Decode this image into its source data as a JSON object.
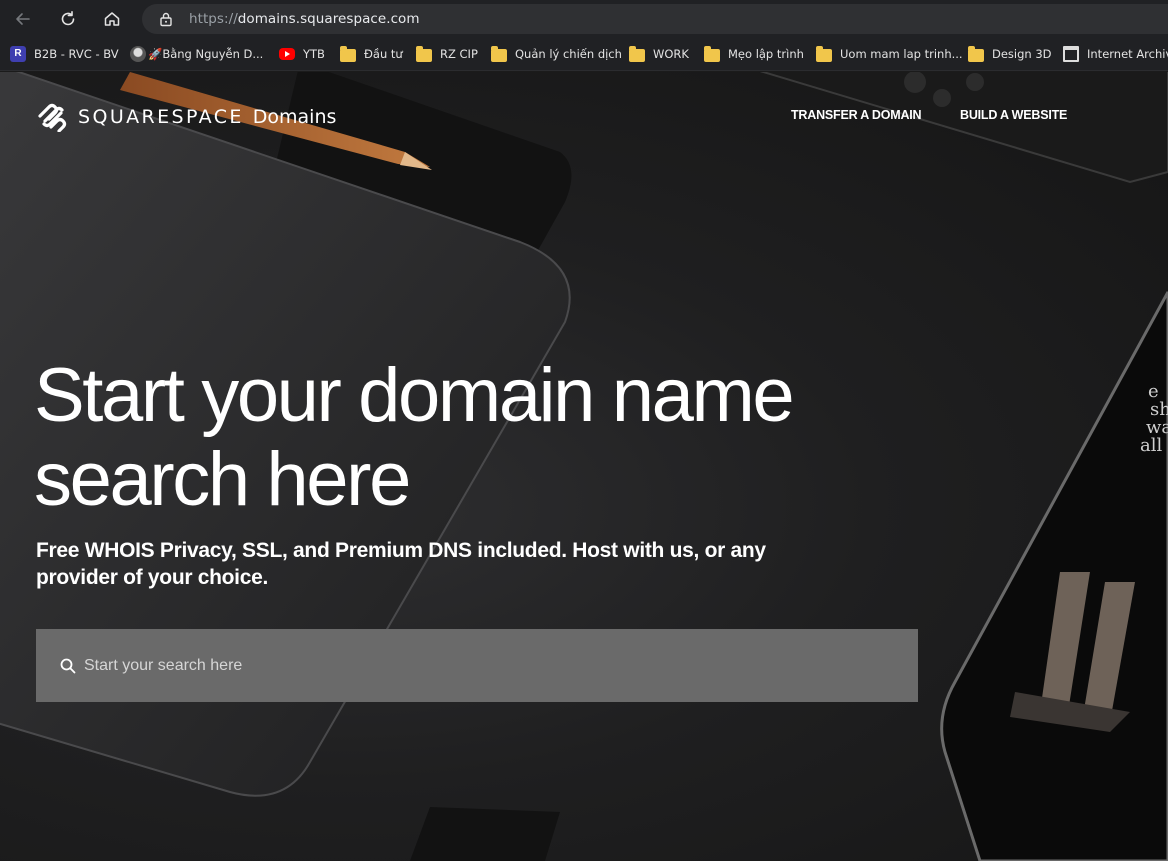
{
  "browser": {
    "url_scheme": "https://",
    "url_host": "domains.squarespace.com",
    "icons": {
      "back": "arrow-left-icon",
      "reload": "reload-icon",
      "home": "home-icon",
      "lock": "lock-icon"
    }
  },
  "bookmarks": [
    {
      "label": "B2B - RVC - BV",
      "icon": "r-app-icon"
    },
    {
      "label": "🚀Bằng Nguyễn D...",
      "icon": "avatar-icon"
    },
    {
      "label": "YTB",
      "icon": "youtube-icon"
    },
    {
      "label": "Đầu tư",
      "icon": "folder-icon"
    },
    {
      "label": "RZ CIP",
      "icon": "folder-icon"
    },
    {
      "label": "Quản lý chiến dịch",
      "icon": "folder-icon"
    },
    {
      "label": "WORK",
      "icon": "folder-icon"
    },
    {
      "label": "Mẹo lập trình",
      "icon": "folder-icon"
    },
    {
      "label": "Uom mam lap trinh...",
      "icon": "folder-icon"
    },
    {
      "label": "Design 3D",
      "icon": "folder-icon"
    },
    {
      "label": "Internet Archive",
      "icon": "museum-icon"
    }
  ],
  "site": {
    "logo_word": "SQUARESPACE",
    "logo_sub": "Domains",
    "nav": {
      "transfer": "TRANSFER A DOMAIN",
      "build": "BUILD A WEBSITE"
    },
    "headline": "Start your domain name search here",
    "subhead": "Free WHOIS Privacy, SSL, and Premium DNS included. Host with us, or any provider of your choice.",
    "search": {
      "placeholder": "Start your search here",
      "value": ""
    }
  }
}
